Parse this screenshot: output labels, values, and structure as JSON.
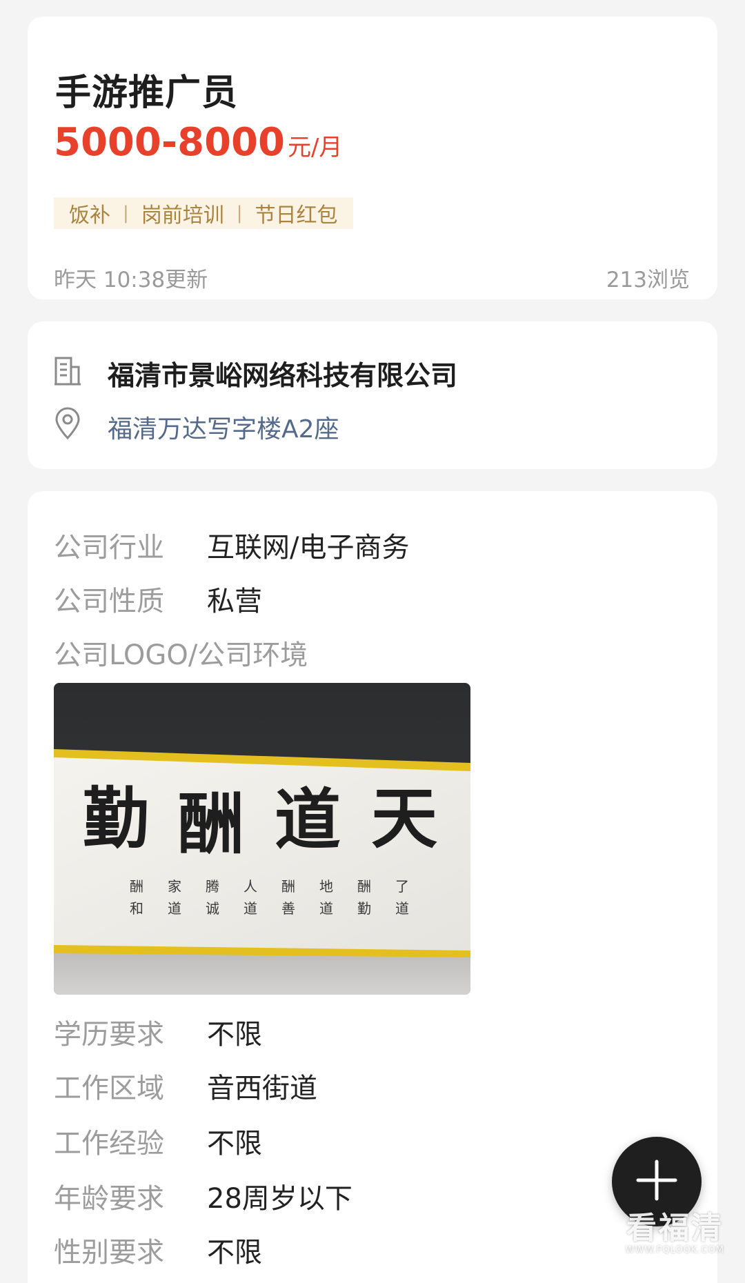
{
  "job": {
    "title": "手游推广员",
    "salary_range": "5000-8000",
    "salary_unit": "元/月",
    "tags": [
      "饭补",
      "岗前培训",
      "节日红包"
    ],
    "tag_separator": "|",
    "updated": "昨天 10:38更新",
    "views": "213浏览"
  },
  "company": {
    "name": "福清市景峪网络科技有限公司",
    "address": "福清万达写字楼A2座",
    "name_icon": "building-icon",
    "address_icon": "location-pin-icon"
  },
  "details": {
    "industry_label": "公司行业",
    "industry_value": "互联网/电子商务",
    "nature_label": "公司性质",
    "nature_value": "私营",
    "logo_label": "公司LOGO/公司环境",
    "photo": {
      "big_text": [
        "勤",
        "酬",
        "道",
        "天"
      ],
      "small_top": [
        "酬",
        "家",
        "腾",
        "人",
        "酬",
        "地",
        "酬",
        "了"
      ],
      "small_bottom": [
        "和",
        "道",
        "诚",
        "道",
        "善",
        "道",
        "勤",
        "道"
      ]
    },
    "education_label": "学历要求",
    "education_value": "不限",
    "area_label": "工作区域",
    "area_value": "音西街道",
    "experience_label": "工作经验",
    "experience_value": "不限",
    "age_label": "年龄要求",
    "age_value": "28周岁以下",
    "gender_label": "性别要求",
    "gender_value": "不限"
  },
  "fab": {
    "icon": "plus-icon"
  },
  "watermark": {
    "main": "看福清",
    "sub": "WWW.FQLOOK.COM"
  },
  "colors": {
    "accent_red": "#e8412b",
    "tag_text": "#a98340",
    "tag_bg": "#fbf4e4",
    "address_blue": "#556a8a",
    "fab_bg": "#1f1f1f"
  }
}
